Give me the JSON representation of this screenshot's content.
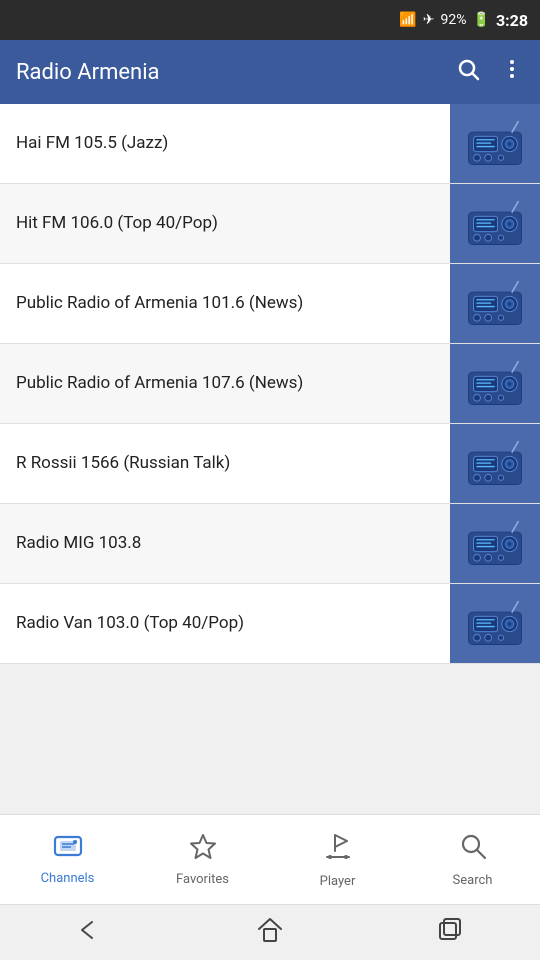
{
  "statusBar": {
    "time": "3:28",
    "battery": "92%"
  },
  "appBar": {
    "title": "Radio Armenia",
    "searchLabel": "search",
    "menuLabel": "more options"
  },
  "stations": [
    {
      "id": 1,
      "name": "Hai FM 105.5 (Jazz)"
    },
    {
      "id": 2,
      "name": "Hit FM 106.0 (Top 40/Pop)"
    },
    {
      "id": 3,
      "name": "Public Radio of Armenia 101.6 (News)"
    },
    {
      "id": 4,
      "name": "Public Radio of Armenia 107.6 (News)"
    },
    {
      "id": 5,
      "name": "R Rossii 1566 (Russian Talk)"
    },
    {
      "id": 6,
      "name": "Radio MIG 103.8"
    },
    {
      "id": 7,
      "name": "Radio Van 103.0 (Top 40/Pop)"
    }
  ],
  "bottomNav": {
    "items": [
      {
        "id": "channels",
        "label": "Channels",
        "active": true
      },
      {
        "id": "favorites",
        "label": "Favorites",
        "active": false
      },
      {
        "id": "player",
        "label": "Player",
        "active": false
      },
      {
        "id": "search",
        "label": "Search",
        "active": false
      }
    ]
  },
  "androidNav": {
    "back": "←",
    "home": "⌂",
    "recents": "▭"
  },
  "colors": {
    "appBarBg": "#3a5a9c",
    "thumbBg": "#4a6aac",
    "activeNav": "#3a7bd5"
  }
}
